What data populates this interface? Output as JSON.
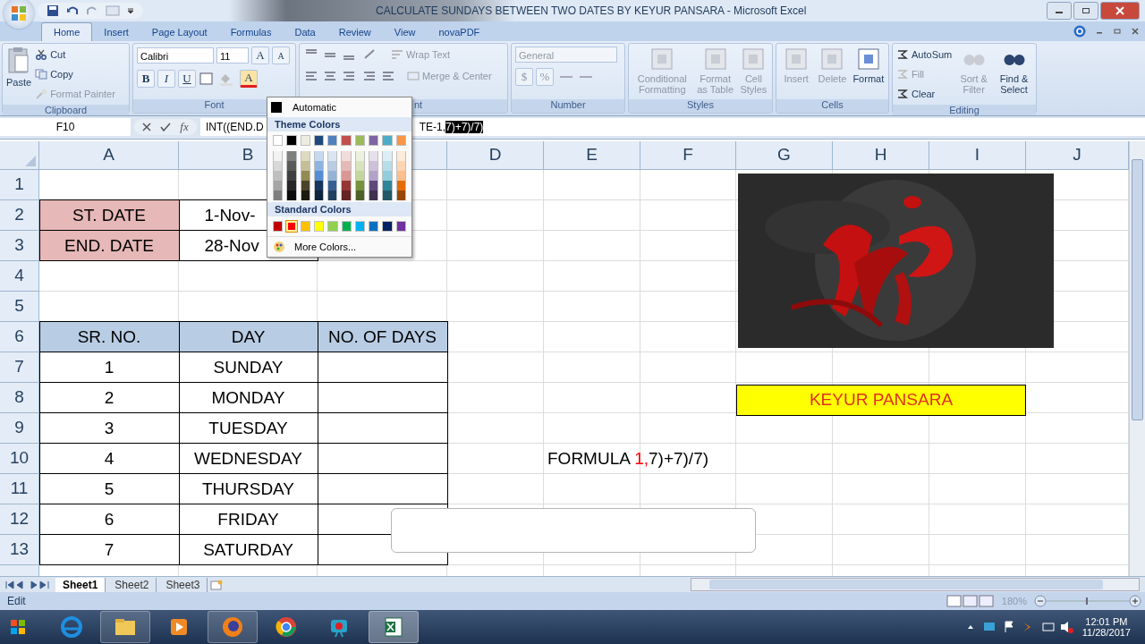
{
  "title_bar": {
    "title": "CALCULATE SUNDAYS BETWEEN TWO DATES BY KEYUR PANSARA - Microsoft Excel"
  },
  "tabs": [
    {
      "label": "Home",
      "selected": true
    },
    {
      "label": "Insert",
      "selected": false
    },
    {
      "label": "Page Layout",
      "selected": false
    },
    {
      "label": "Formulas",
      "selected": false
    },
    {
      "label": "Data",
      "selected": false
    },
    {
      "label": "Review",
      "selected": false
    },
    {
      "label": "View",
      "selected": false
    },
    {
      "label": "novaPDF",
      "selected": false
    }
  ],
  "ribbon": {
    "clipboard": {
      "label": "Clipboard",
      "paste": "Paste",
      "small": [
        {
          "label": "Cut",
          "disabled": false
        },
        {
          "label": "Copy",
          "disabled": false
        },
        {
          "label": "Format Painter",
          "disabled": true
        }
      ]
    },
    "font": {
      "label": "Font",
      "font_name": "Calibri",
      "font_size": "11",
      "grow": "A",
      "shrink": "A",
      "styles": [
        "B",
        "I",
        "U"
      ],
      "color_glyph": "A"
    },
    "alignment": {
      "label": "nt",
      "wrap_text": {
        "label": "Wrap Text",
        "disabled": true
      },
      "merge": {
        "label": "Merge & Center",
        "disabled": true
      }
    },
    "number": {
      "label": "Number",
      "format": "General",
      "disabled": true,
      "symbols": [
        "$",
        "%"
      ]
    },
    "styles": {
      "label": "Styles",
      "buttons": [
        {
          "label": "Conditional Formatting",
          "disabled": true
        },
        {
          "label": "Format as Table",
          "disabled": true
        },
        {
          "label": "Cell Styles",
          "disabled": true
        }
      ]
    },
    "cells": {
      "label": "Cells",
      "buttons": [
        {
          "label": "Insert",
          "disabled": true
        },
        {
          "label": "Delete",
          "disabled": true
        },
        {
          "label": "Format",
          "disabled": false
        }
      ]
    },
    "editing": {
      "label": "Editing",
      "small": [
        {
          "label": "AutoSum",
          "disabled": false
        },
        {
          "label": "Fill",
          "disabled": true
        },
        {
          "label": "Clear",
          "disabled": false
        }
      ],
      "buttons": [
        {
          "label": "Sort & Filter",
          "disabled": true
        },
        {
          "label": "Find & Select",
          "disabled": false
        }
      ]
    }
  },
  "formula_bar": {
    "name_box": "F10",
    "fx": "fx",
    "formula_start": "INT((END.D",
    "formula_end": "TE-1,",
    "formula_selected": "7)+7)/7)"
  },
  "color_menu": {
    "automatic": "Automatic",
    "theme_title": "Theme Colors",
    "theme_colors": [
      [
        {
          "color": "#ffffff"
        },
        {
          "color": "#000000"
        },
        {
          "color": "#eeece1"
        },
        {
          "color": "#1f497d"
        },
        {
          "color": "#4f81bd"
        },
        {
          "color": "#c0504d"
        },
        {
          "color": "#9bbb59"
        },
        {
          "color": "#8064a2"
        },
        {
          "color": "#4bacc6"
        },
        {
          "color": "#f79646"
        }
      ],
      [
        {
          "color": "#f2f2f2"
        },
        {
          "color": "#7f7f7f"
        },
        {
          "color": "#ddd9c3"
        },
        {
          "color": "#c6d9f0"
        },
        {
          "color": "#dbe5f1"
        },
        {
          "color": "#f2dcdb"
        },
        {
          "color": "#ebf1dd"
        },
        {
          "color": "#e5e0ec"
        },
        {
          "color": "#dbeef3"
        },
        {
          "color": "#fdeada"
        }
      ],
      [
        {
          "color": "#d8d8d8"
        },
        {
          "color": "#595959"
        },
        {
          "color": "#c4bd97"
        },
        {
          "color": "#8db3e2"
        },
        {
          "color": "#b8cce4"
        },
        {
          "color": "#e5b9b7"
        },
        {
          "color": "#d7e3bc"
        },
        {
          "color": "#ccc1d9"
        },
        {
          "color": "#b7dde8"
        },
        {
          "color": "#fbd5b5"
        }
      ],
      [
        {
          "color": "#bfbfbf"
        },
        {
          "color": "#3f3f3f"
        },
        {
          "color": "#938953"
        },
        {
          "color": "#548dd4"
        },
        {
          "color": "#95b3d7"
        },
        {
          "color": "#d99694"
        },
        {
          "color": "#c3d69b"
        },
        {
          "color": "#b2a2c7"
        },
        {
          "color": "#92cddc"
        },
        {
          "color": "#fac08f"
        }
      ],
      [
        {
          "color": "#a5a5a5"
        },
        {
          "color": "#262626"
        },
        {
          "color": "#494429"
        },
        {
          "color": "#17365d"
        },
        {
          "color": "#366092"
        },
        {
          "color": "#953734"
        },
        {
          "color": "#76923c"
        },
        {
          "color": "#5f497a"
        },
        {
          "color": "#31859b"
        },
        {
          "color": "#e36c09"
        }
      ],
      [
        {
          "color": "#7f7f7f"
        },
        {
          "color": "#0c0c0c"
        },
        {
          "color": "#1d1b10"
        },
        {
          "color": "#0f243e"
        },
        {
          "color": "#244061"
        },
        {
          "color": "#632423"
        },
        {
          "color": "#4f6128"
        },
        {
          "color": "#3f3151"
        },
        {
          "color": "#205867"
        },
        {
          "color": "#974806"
        }
      ]
    ],
    "standard_title": "Standard Colors",
    "standard_colors": [
      {
        "color": "#c00000",
        "selected": false
      },
      {
        "color": "#ff0000",
        "selected": true
      },
      {
        "color": "#ffc000",
        "selected": false
      },
      {
        "color": "#ffff00",
        "selected": false
      },
      {
        "color": "#92d050",
        "selected": false
      },
      {
        "color": "#00b050",
        "selected": false
      },
      {
        "color": "#00b0f0",
        "selected": false
      },
      {
        "color": "#0070c0",
        "selected": false
      },
      {
        "color": "#002060",
        "selected": false
      },
      {
        "color": "#7030a0",
        "selected": false
      }
    ],
    "more": "More Colors..."
  },
  "sheet": {
    "columns_left": [
      "A",
      "B"
    ],
    "columns_right": [
      "D",
      "E",
      "F",
      "G",
      "H",
      "I",
      "J"
    ],
    "rows": [
      {
        "number": "1",
        "kind": "blank",
        "cells": {}
      },
      {
        "number": "2",
        "kind": "date",
        "cells": {
          "a": "ST. DATE",
          "b": "1-Nov-"
        }
      },
      {
        "number": "3",
        "kind": "date",
        "cells": {
          "a": "END. DATE",
          "b": "28-Nov"
        }
      },
      {
        "number": "4",
        "kind": "blank",
        "cells": {}
      },
      {
        "number": "5",
        "kind": "blank",
        "cells": {}
      },
      {
        "number": "6",
        "kind": "table-head",
        "cells": {
          "a": "SR. NO.",
          "b": "DAY",
          "c": "NO. OF DAYS"
        }
      },
      {
        "number": "7",
        "kind": "table",
        "cells": {
          "a": "1",
          "b": "SUNDAY"
        }
      },
      {
        "number": "8",
        "kind": "table",
        "cells": {
          "a": "2",
          "b": "MONDAY"
        }
      },
      {
        "number": "9",
        "kind": "table",
        "cells": {
          "a": "3",
          "b": "TUESDAY"
        }
      },
      {
        "number": "10",
        "kind": "table",
        "cells": {
          "a": "4",
          "b": "WEDNESDAY",
          "e": [
            {
              "text": "FORMULA ",
              "color": "#000000"
            },
            {
              "text": "1,",
              "color": "#ff0000"
            },
            {
              "text": "7)+7)/7)",
              "color": "#000000"
            }
          ]
        }
      },
      {
        "number": "11",
        "kind": "table",
        "cells": {
          "a": "5",
          "b": "THURSDAY"
        }
      },
      {
        "number": "12",
        "kind": "table",
        "cells": {
          "a": "6",
          "b": "FRIDAY"
        }
      },
      {
        "number": "13",
        "kind": "table",
        "cells": {
          "a": "7",
          "b": "SATURDAY"
        }
      }
    ],
    "name_banner": "KEYUR PANSARA",
    "tabs": [
      {
        "label": "Sheet1",
        "selected": true
      },
      {
        "label": "Sheet2",
        "selected": false
      },
      {
        "label": "Sheet3",
        "selected": false
      }
    ]
  },
  "status_bar": {
    "mode": "Edit",
    "zoom": "180%"
  },
  "taskbar": {
    "apps": [
      {
        "running": false,
        "selected": false
      },
      {
        "running": true,
        "selected": false
      },
      {
        "running": false,
        "selected": false
      },
      {
        "running": true,
        "selected": false
      },
      {
        "running": false,
        "selected": false
      },
      {
        "running": false,
        "selected": false
      },
      {
        "running": true,
        "selected": true
      }
    ],
    "time": "12:01 PM",
    "date": "11/28/2017"
  }
}
